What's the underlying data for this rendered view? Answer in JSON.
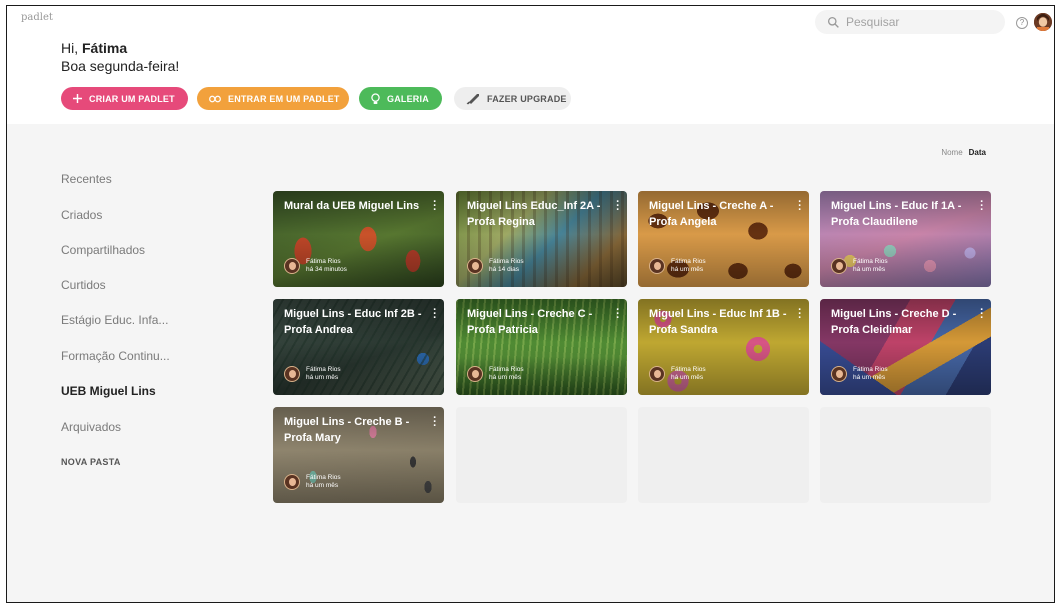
{
  "header": {
    "brand": "padlet",
    "search_placeholder": "Pesquisar",
    "help_icon": "?",
    "greeting_prefix": "Hi, ",
    "user_name": "Fátima",
    "greeting_line2": "Boa segunda-feira!"
  },
  "actions": {
    "create": "CRIAR UM PADLET",
    "join": "ENTRAR EM UM PADLET",
    "gallery": "GALERIA",
    "upgrade": "FAZER UPGRADE"
  },
  "sort": {
    "name": "Nome",
    "date": "Data"
  },
  "sidebar": {
    "items": [
      {
        "label": "Recentes",
        "active": false
      },
      {
        "label": "Criados",
        "active": false
      },
      {
        "label": "Compartilhados",
        "active": false
      },
      {
        "label": "Curtidos",
        "active": false
      },
      {
        "label": "Estágio Educ. Infa...",
        "active": false
      },
      {
        "label": "Formação Continu...",
        "active": false
      },
      {
        "label": "UEB Miguel Lins",
        "active": true
      },
      {
        "label": "Arquivados",
        "active": false
      }
    ],
    "new_folder": "NOVA PASTA"
  },
  "padlets": [
    {
      "title": "Mural da UEB Miguel Lins",
      "owner": "Fátima Rios",
      "time": "há 34 minutos",
      "theme": "tulips"
    },
    {
      "title": "Miguel Lins Educ_Inf 2A - Profa Regina",
      "owner": "Fátima Rios",
      "time": "há 14 dias",
      "theme": "wood"
    },
    {
      "title": "Miguel Lins - Creche A - Profa Angela",
      "owner": "Fátima Rios",
      "time": "há um mês",
      "theme": "giraffe"
    },
    {
      "title": "Miguel Lins - Educ If 1A - Profa Claudilene",
      "owner": "Fátima Rios",
      "time": "há um mês",
      "theme": "marshmallow"
    },
    {
      "title": "Miguel Lins - Educ Inf 2B - Profa Andrea",
      "owner": "Fátima Rios",
      "time": "há um mês",
      "theme": "peacock"
    },
    {
      "title": "Miguel Lins - Creche C - Profa Patricia",
      "owner": "Fátima Rios",
      "time": "há um mês",
      "theme": "grass"
    },
    {
      "title": "Miguel Lins - Educ Inf 1B - Profa Sandra",
      "owner": "Fátima Rios",
      "time": "há um mês",
      "theme": "donuts"
    },
    {
      "title": "Miguel Lins - Creche D - Profa Cleidimar",
      "owner": "Fátima Rios",
      "time": "há um mês",
      "theme": "geometric"
    },
    {
      "title": "Miguel Lins - Creche B - Profa Mary",
      "owner": "Fátima Rios",
      "time": "há um mês",
      "theme": "icecream"
    }
  ],
  "colors": {
    "create": "#e64a7a",
    "join": "#f2a13c",
    "gallery": "#4dba5a",
    "upgrade": "#eeeeee",
    "content_bg": "#f5f5f5"
  },
  "icons": {
    "search": "search-icon",
    "help": "help-icon",
    "plus": "plus-icon",
    "link": "link-icon",
    "gallery": "lightbulb-icon",
    "upgrade": "rocket-icon",
    "more": "more-vertical-icon"
  }
}
